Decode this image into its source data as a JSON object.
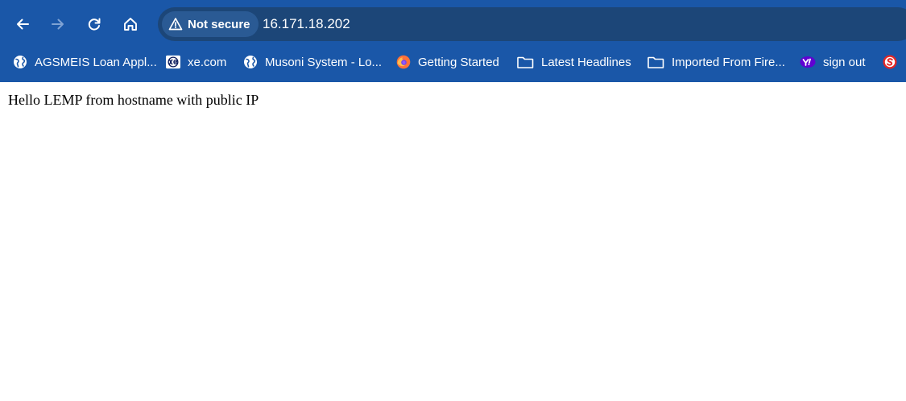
{
  "browser": {
    "nav": {
      "back_icon": "arrow-left-icon",
      "forward_icon": "arrow-right-icon",
      "reload_icon": "reload-icon",
      "home_icon": "home-icon"
    },
    "omnibox": {
      "security_label": "Not secure",
      "security_icon": "warning-triangle-icon",
      "url": "16.171.18.202"
    },
    "bookmarks": [
      {
        "label": "AGSMEIS Loan Appl...",
        "icon": "globe-icon"
      },
      {
        "label": "xe.com",
        "icon": "xe-logo-icon"
      },
      {
        "label": "Musoni System - Lo...",
        "icon": "globe-icon"
      },
      {
        "label": "Getting Started",
        "icon": "firefox-icon"
      },
      {
        "label": "Latest Headlines",
        "icon": "folder-icon"
      },
      {
        "label": "Imported From Fire...",
        "icon": "folder-icon"
      },
      {
        "label": "sign out",
        "icon": "yahoo-icon"
      },
      {
        "label": "",
        "icon": "s-logo-icon"
      }
    ],
    "colors": {
      "frame": "#1a57a8",
      "omnibox": "#1c4678",
      "security_chip": "#2a5a94"
    }
  },
  "page": {
    "text": "Hello LEMP from hostname with public IP"
  }
}
